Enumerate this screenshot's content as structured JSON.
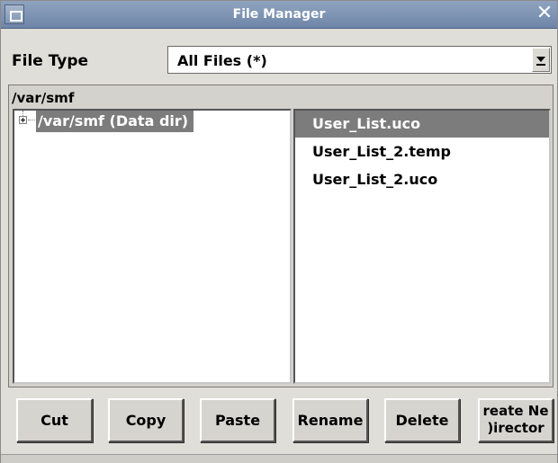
{
  "window": {
    "title": "File Manager",
    "close_glyph": "✕"
  },
  "file_type": {
    "label": "File Type",
    "value": "All Files (*)"
  },
  "path": {
    "current": "/var/smf"
  },
  "tree": {
    "node_label": "/var/smf (Data dir)"
  },
  "files": {
    "items": [
      "User_List.uco",
      "User_List_2.temp",
      "User_List_2.uco"
    ],
    "selected_index": 0
  },
  "buttons": {
    "cut": "Cut",
    "copy": "Copy",
    "paste": "Paste",
    "rename": "Rename",
    "delete": "Delete",
    "create_dir_line1": "reate Ne",
    "create_dir_line2": ")irector"
  },
  "colors": {
    "selection": "#7c7c7c",
    "titlebar": "#7f94b4"
  },
  "icons": {
    "system_menu": "window-menu-icon",
    "close": "close-icon",
    "expander": "tree-expand-plus-icon",
    "dropdown": "chevron-down-icon"
  }
}
